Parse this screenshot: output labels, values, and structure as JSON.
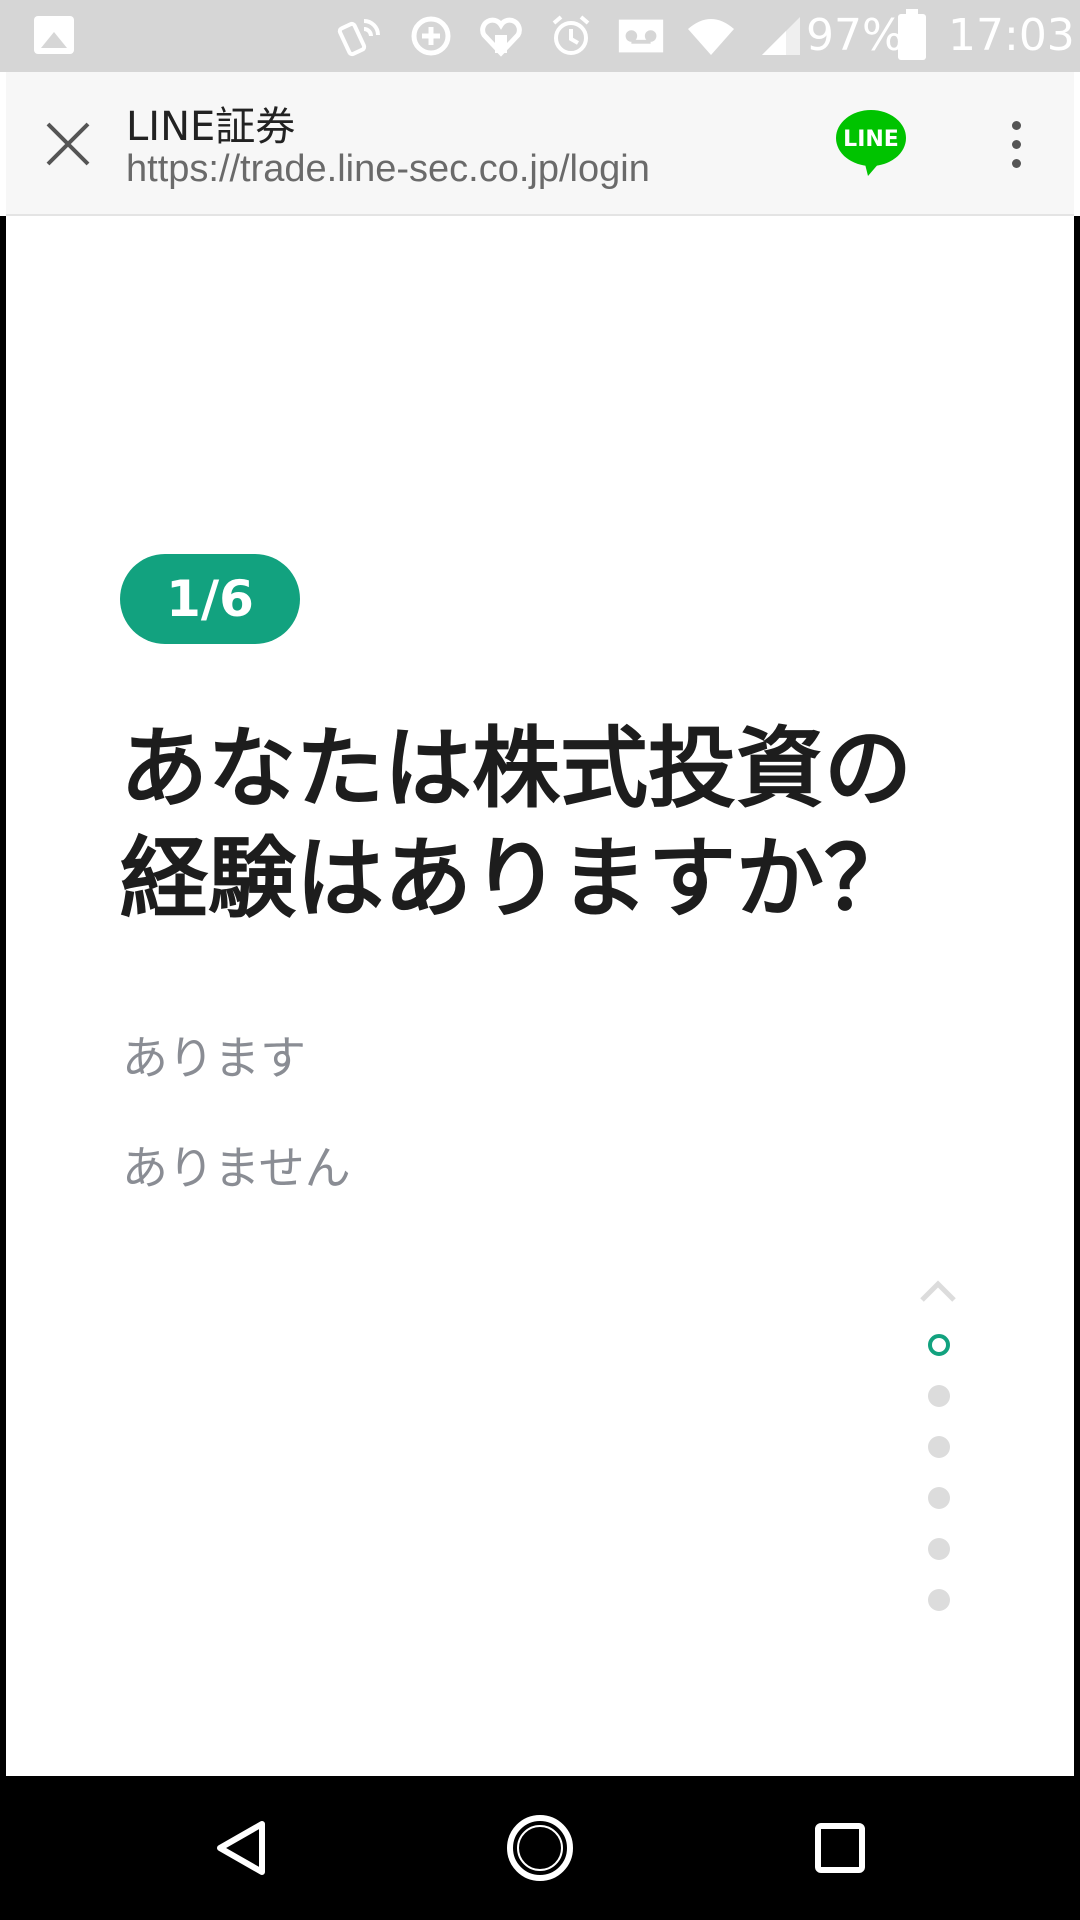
{
  "status_bar": {
    "battery_percent": "97%",
    "time": "17:03",
    "icons": [
      "gallery-icon",
      "nfc-icon",
      "data-saver-icon",
      "health-icon",
      "alarm-icon",
      "voicemail-icon",
      "wifi-icon",
      "cell-signal-icon",
      "battery-icon"
    ]
  },
  "header": {
    "title": "LINE証券",
    "url": "https://trade.line-sec.co.jp/login",
    "logo_text": "LINE",
    "brand_color": "#00c300"
  },
  "quiz": {
    "step": "1/6",
    "question": "あなたは株式投資の経験はありますか？",
    "options": [
      "あります",
      "ありません"
    ],
    "current_step": 1,
    "total_steps": 6,
    "accent_color": "#12a27f"
  },
  "nav_bar": {
    "icons": [
      "back-icon",
      "home-icon",
      "recent-apps-icon"
    ]
  }
}
